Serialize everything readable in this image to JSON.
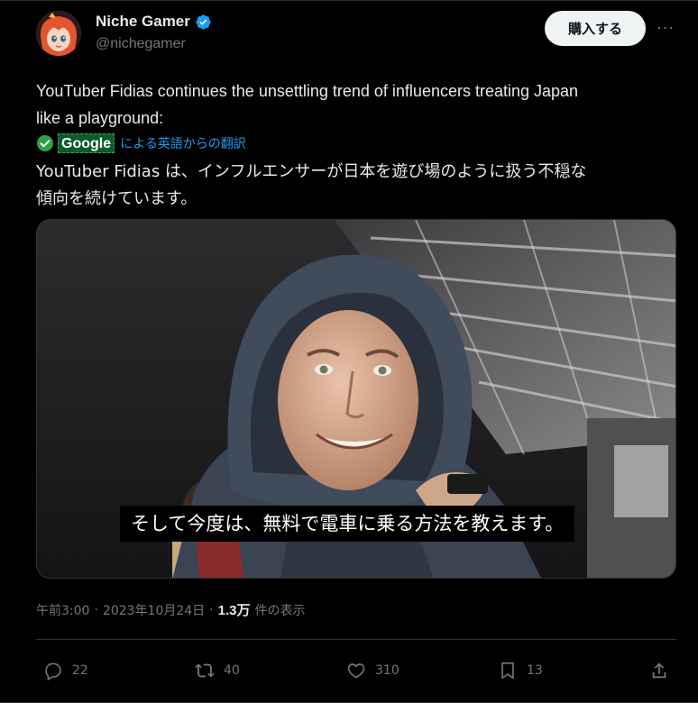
{
  "author": {
    "name": "Niche Gamer",
    "handle": "@nichegamer",
    "verified": true
  },
  "buy_button_label": "購入する",
  "more_label": "···",
  "tweet": {
    "text_line1": "YouTuber Fidias continues the unsettling trend of influencers treating Japan",
    "text_line2": "like a playground:"
  },
  "translation": {
    "provider": "Google",
    "label": "による英語からの翻訳",
    "text_line1": "YouTuber Fidias は、インフルエンサーが日本を遊び場のように扱う不穏な",
    "text_line2": "傾向を続けています。"
  },
  "media": {
    "subtitle": "そして今度は、無料で電車に乗る方法を教えます。"
  },
  "meta": {
    "time": "午前3:00",
    "date": "2023年10月24日",
    "views_count": "1.3万",
    "views_label": "件の表示"
  },
  "actions": {
    "replies": "22",
    "reposts": "40",
    "likes": "310",
    "bookmarks": "13"
  },
  "colors": {
    "background": "#000000",
    "text": "#e7e9ea",
    "secondary": "#71767b",
    "link": "#1d9bf0",
    "verified": "#1d9bf0",
    "border": "#2f3336"
  }
}
